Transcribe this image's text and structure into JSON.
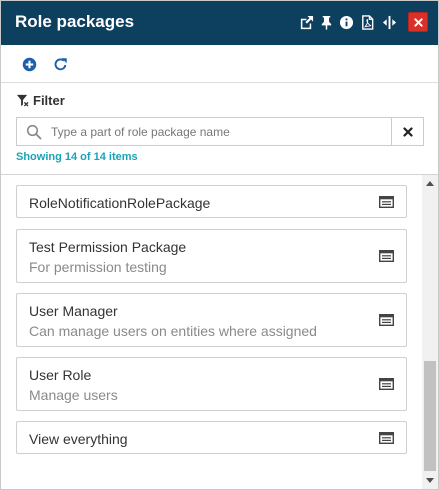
{
  "header": {
    "title": "Role packages",
    "icons": [
      "external-link-icon",
      "pin-icon",
      "info-icon",
      "pdf-icon",
      "resize-icon",
      "close-icon"
    ],
    "bg_color": "#0d3f5f",
    "close_color": "#d9302a"
  },
  "toolbar": {
    "icons": [
      "add-icon",
      "refresh-icon"
    ],
    "icon_color": "#1a5fa8"
  },
  "filter": {
    "label": "Filter",
    "search_placeholder": "Type a part of role package name",
    "search_value": "",
    "showing": "Showing 14 of 14 items",
    "showing_color": "#1aa3b8"
  },
  "items": [
    {
      "name": "RoleNotificationRolePackage",
      "description": ""
    },
    {
      "name": "Test Permission Package",
      "description": "For permission testing"
    },
    {
      "name": "User Manager",
      "description": "Can manage users on entities where assigned"
    },
    {
      "name": "User Role",
      "description": "Manage users"
    },
    {
      "name": "View everything",
      "description": ""
    }
  ]
}
